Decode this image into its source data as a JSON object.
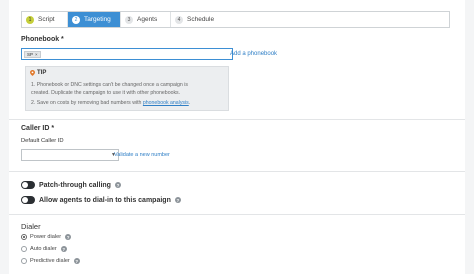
{
  "tabs": [
    {
      "num": "1",
      "label": "Script",
      "state": "done"
    },
    {
      "num": "2",
      "label": "Targeting",
      "state": "active"
    },
    {
      "num": "3",
      "label": "Agents",
      "state": "todo"
    },
    {
      "num": "4",
      "label": "Schedule",
      "state": "todo"
    }
  ],
  "phonebook": {
    "label": "Phonebook *",
    "chip": "SP",
    "chip_remove": "×",
    "add_link": "Add a phonebook"
  },
  "tip": {
    "title": "TIP",
    "line1": "1. Phonebook or DNC settings can't be changed once a campaign is",
    "line2": "created. Duplicate the campaign to use it with other phonebooks.",
    "line3_prefix": "2. Save on costs by removing bad numbers with ",
    "line3_link": "phonebook analysis",
    "line3_suffix": "."
  },
  "caller_id": {
    "label": "Caller ID *",
    "default_label": "Default Caller ID",
    "validate_link": "Validate a new number"
  },
  "toggles": {
    "patch_through": "Patch-through calling",
    "allow_agents": "Allow agents to dial-in to this campaign"
  },
  "dialer": {
    "label": "Dialer",
    "options": [
      {
        "label": "Power dialer",
        "checked": true
      },
      {
        "label": "Auto dialer",
        "checked": false
      },
      {
        "label": "Predictive dialer",
        "checked": false
      }
    ]
  },
  "colors": {
    "accent": "#3d8fd4",
    "done": "#c5cf3a",
    "link": "#2f7fc6"
  },
  "icons": {
    "tip": "pin-icon",
    "help": "question-circle-icon",
    "remove": "close-icon",
    "caret": "chevron-down-icon"
  }
}
